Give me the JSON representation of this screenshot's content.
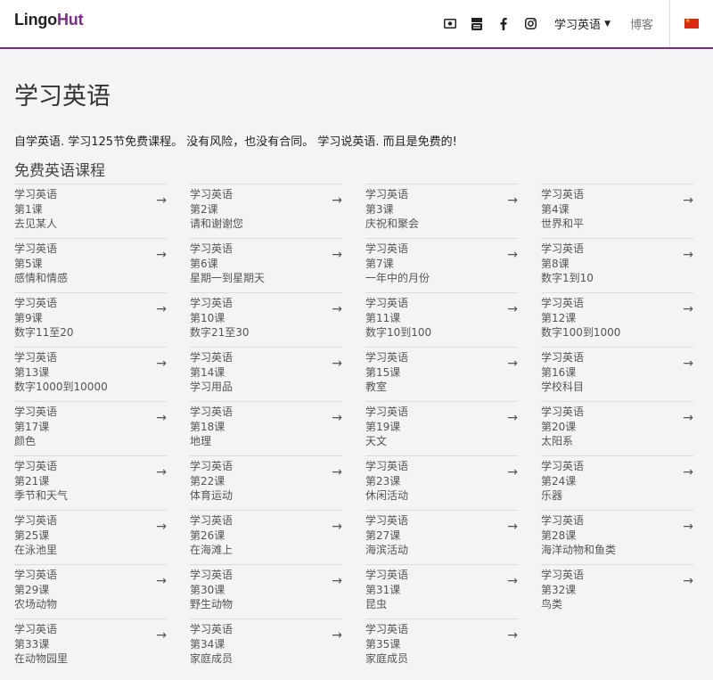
{
  "header": {
    "logo_part1": "Lingo",
    "logo_part2": "Hut",
    "icons": [
      "money-icon",
      "youtube-icon",
      "facebook-icon",
      "instagram-icon"
    ],
    "lang_menu": "学习英语",
    "blog": "博客",
    "flag": "china-flag-icon",
    "accent_color": "#7b2a8c"
  },
  "page": {
    "title": "学习英语",
    "intro": "自学英语. 学习125节免费课程。 没有风险，也没有合同。 学习说英语. 而且是免费的!",
    "section_title": "免费英语课程"
  },
  "lessons": [
    {
      "course": "学习英语",
      "number": "第1课",
      "topic": "去见某人"
    },
    {
      "course": "学习英语",
      "number": "第2课",
      "topic": "请和谢谢您"
    },
    {
      "course": "学习英语",
      "number": "第3课",
      "topic": "庆祝和聚会"
    },
    {
      "course": "学习英语",
      "number": "第4课",
      "topic": "世界和平"
    },
    {
      "course": "学习英语",
      "number": "第5课",
      "topic": "感情和情感"
    },
    {
      "course": "学习英语",
      "number": "第6课",
      "topic": "星期一到星期天"
    },
    {
      "course": "学习英语",
      "number": "第7课",
      "topic": "一年中的月份"
    },
    {
      "course": "学习英语",
      "number": "第8课",
      "topic": "数字1到10"
    },
    {
      "course": "学习英语",
      "number": "第9课",
      "topic": "数字11至20"
    },
    {
      "course": "学习英语",
      "number": "第10课",
      "topic": "数字21至30"
    },
    {
      "course": "学习英语",
      "number": "第11课",
      "topic": "数字10到100"
    },
    {
      "course": "学习英语",
      "number": "第12课",
      "topic": "数字100到1000"
    },
    {
      "course": "学习英语",
      "number": "第13课",
      "topic": "数字1000到10000"
    },
    {
      "course": "学习英语",
      "number": "第14课",
      "topic": "学习用品"
    },
    {
      "course": "学习英语",
      "number": "第15课",
      "topic": "教室"
    },
    {
      "course": "学习英语",
      "number": "第16课",
      "topic": "学校科目"
    },
    {
      "course": "学习英语",
      "number": "第17课",
      "topic": "颜色"
    },
    {
      "course": "学习英语",
      "number": "第18课",
      "topic": "地理"
    },
    {
      "course": "学习英语",
      "number": "第19课",
      "topic": "天文"
    },
    {
      "course": "学习英语",
      "number": "第20课",
      "topic": "太阳系"
    },
    {
      "course": "学习英语",
      "number": "第21课",
      "topic": "季节和天气"
    },
    {
      "course": "学习英语",
      "number": "第22课",
      "topic": "体育运动"
    },
    {
      "course": "学习英语",
      "number": "第23课",
      "topic": "休闲活动"
    },
    {
      "course": "学习英语",
      "number": "第24课",
      "topic": "乐器"
    },
    {
      "course": "学习英语",
      "number": "第25课",
      "topic": "在泳池里"
    },
    {
      "course": "学习英语",
      "number": "第26课",
      "topic": "在海滩上"
    },
    {
      "course": "学习英语",
      "number": "第27课",
      "topic": "海滨活动"
    },
    {
      "course": "学习英语",
      "number": "第28课",
      "topic": "海洋动物和鱼类"
    },
    {
      "course": "学习英语",
      "number": "第29课",
      "topic": "农场动物"
    },
    {
      "course": "学习英语",
      "number": "第30课",
      "topic": "野生动物"
    },
    {
      "course": "学习英语",
      "number": "第31课",
      "topic": "昆虫"
    },
    {
      "course": "学习英语",
      "number": "第32课",
      "topic": "鸟类"
    },
    {
      "course": "学习英语",
      "number": "第33课",
      "topic": "在动物园里"
    },
    {
      "course": "学习英语",
      "number": "第34课",
      "topic": "家庭成员"
    },
    {
      "course": "学习英语",
      "number": "第35课",
      "topic": "家庭成员"
    }
  ],
  "arrow_glyph": "→"
}
